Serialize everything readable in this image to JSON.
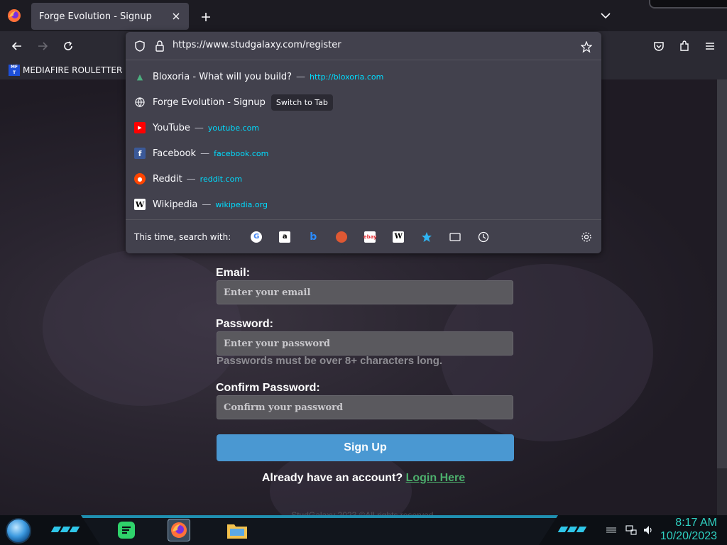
{
  "browser": {
    "tab": {
      "title": "Forge Evolution - Signup",
      "close_glyph": "✕"
    },
    "new_tab_glyph": "+",
    "url": "https://www.studgalaxy.com/register",
    "bookmarks": [
      {
        "label": "MEDIAFIRE ROULETTER",
        "icon_text": "MF T"
      }
    ]
  },
  "url_dropdown": {
    "results": [
      {
        "title": "Bloxoria - What will you build?",
        "url": "http://bloxoria.com",
        "icon": "bloxoria-icon"
      },
      {
        "title": "Forge Evolution - Signup",
        "action": "Switch to Tab",
        "icon": "globe-icon"
      },
      {
        "title": "YouTube",
        "url": "youtube.com",
        "icon": "youtube-icon"
      },
      {
        "title": "Facebook",
        "url": "facebook.com",
        "icon": "facebook-icon"
      },
      {
        "title": "Reddit",
        "url": "reddit.com",
        "icon": "reddit-icon"
      },
      {
        "title": "Wikipedia",
        "url": "wikipedia.org",
        "icon": "wikipedia-icon"
      }
    ],
    "separator": "—",
    "search_label": "This time, search with:",
    "engines": [
      "google",
      "amazon",
      "bing",
      "duckduckgo",
      "ebay",
      "wikipedia",
      "bookmarks",
      "tabs",
      "history"
    ]
  },
  "form": {
    "email_label": "Email:",
    "email_placeholder": "Enter your email",
    "password_label": "Password:",
    "password_placeholder": "Enter your password",
    "password_hint": "Passwords must be over 8+ characters long.",
    "confirm_label": "Confirm Password:",
    "confirm_placeholder": "Confirm your password",
    "submit_label": "Sign Up",
    "login_prompt": "Already have an account?",
    "login_link": "Login Here",
    "footer": "StudGalaxy 2023 ©All rights reserved."
  },
  "taskbar": {
    "time": "8:17 AM",
    "date": "10/20/2023"
  },
  "colors": {
    "accent_blue": "#4a98d2",
    "link_green": "#4cae6c",
    "url_cyan": "#00ddff",
    "clock_teal": "#2fd1c2"
  }
}
